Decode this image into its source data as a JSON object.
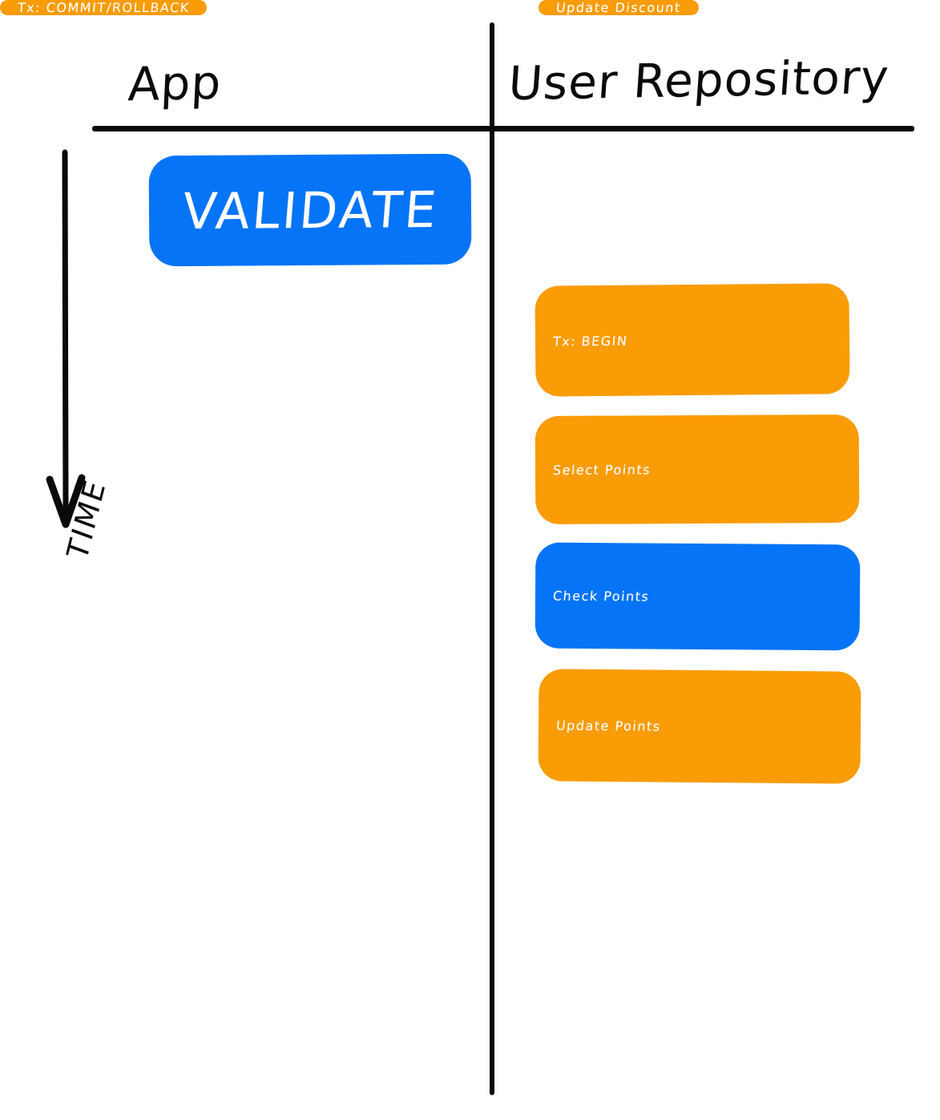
{
  "diagram": {
    "type": "swimlane-sequence",
    "orientation": "vertical-time",
    "colors": {
      "blue": "#0574f7",
      "orange": "#f99c06",
      "ink": "#0a0a0a",
      "text_on_fill": "#ffffff",
      "background": "#ffffff"
    },
    "axis": {
      "label": "TIME",
      "direction": "downward",
      "arrow_icon": "down-arrow-icon"
    },
    "lanes": [
      {
        "id": "app",
        "title": "App",
        "nodes": [
          {
            "id": "validate",
            "label": "VALIDATE",
            "color": "#0574f7",
            "order": 1
          }
        ]
      },
      {
        "id": "user-repository",
        "title": "User Repository",
        "nodes": [
          {
            "id": "tx-begin",
            "label": "Tx: BEGIN",
            "color": "#f99c06",
            "order": 2
          },
          {
            "id": "select-points",
            "label": "Select Points",
            "color": "#f99c06",
            "order": 3
          },
          {
            "id": "check-points",
            "label": "Check Points",
            "color": "#0574f7",
            "order": 4
          },
          {
            "id": "update-points",
            "label": "Update Points",
            "color": "#f99c06",
            "order": 5
          },
          {
            "id": "update-discount",
            "label": "Update Discount",
            "color": "#f99c06",
            "order": 6
          },
          {
            "id": "tx-commit",
            "label": "Tx: COMMIT",
            "sublabel": "/ROLLBACK",
            "color": "#f99c06",
            "order": 7
          }
        ]
      }
    ]
  }
}
